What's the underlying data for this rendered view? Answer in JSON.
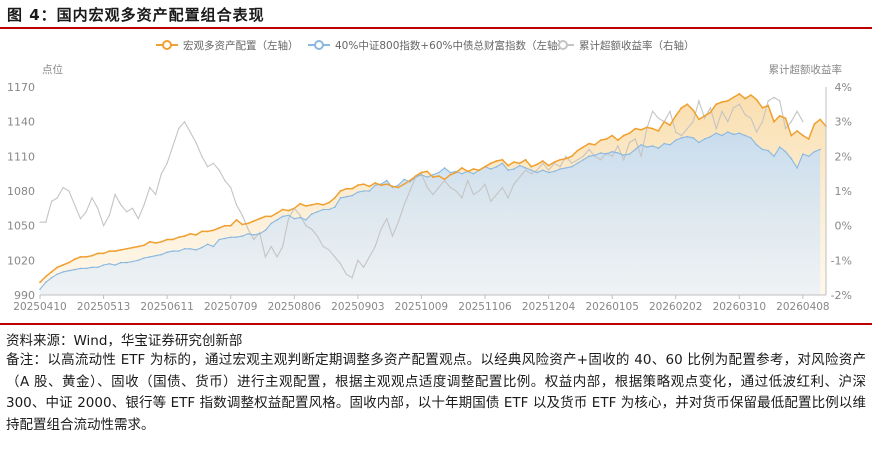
{
  "figure": {
    "title": "图 4：国内宏观多资产配置组合表现",
    "source": "资料来源：Wind，华宝证券研究创新部",
    "note": "备注：以高流动性 ETF 为标的，通过宏观主观判断定期调整多资产配置观点。以经典风险资产+固收的 40、60 比例为配置参考，对风险资产（A 股、黄金）、固收（国债、货币）进行主观配置，根据主观观点适度调整配置比例。权益内部，根据策略观点变化，通过低波红利、沪深 300、中证 2000、银行等 ETF 指数调整权益配置风格。固收内部，以十年期国债 ETF 以及货币 ETF 为核心，并对货币保留最低配置比例以维持配置组合流动性需求。"
  },
  "colors": {
    "accent_red": "#c00000",
    "portfolio": "#f0a030",
    "benchmark": "#8ab8e0",
    "excess": "#c4c4c4"
  },
  "chart_data": {
    "type": "line",
    "left_axis_label": "点位",
    "right_axis_label": "累计超额收益率",
    "ylim_left": [
      990,
      1170
    ],
    "yticks_left": [
      "990",
      "1020",
      "1050",
      "1080",
      "1110",
      "1140",
      "1170"
    ],
    "ylim_right": [
      -2,
      4
    ],
    "yticks_right": [
      "-2%",
      "-1%",
      "0%",
      "1%",
      "2%",
      "3%",
      "4%"
    ],
    "x_ticks": [
      "20250410",
      "20250513",
      "20250611",
      "20250709",
      "20250806",
      "20250903",
      "20251009",
      "20251106",
      "20251204",
      "20260105",
      "20260202",
      "20260310",
      "20260408"
    ],
    "x_tick_index": [
      0,
      11,
      22,
      33,
      44,
      55,
      66,
      77,
      88,
      99,
      110,
      121,
      132
    ],
    "grid": false,
    "legend_position": "top",
    "series": [
      {
        "name": "宏观多资产配置（左轴）",
        "axis": "left",
        "style": "line-area-markers",
        "values": [
          1001,
          1006,
          1010,
          1014,
          1016,
          1018,
          1021,
          1023,
          1023,
          1024,
          1026,
          1026,
          1028,
          1028,
          1029,
          1030,
          1031,
          1032,
          1033,
          1036,
          1035,
          1036,
          1038,
          1038,
          1040,
          1041,
          1043,
          1042,
          1045,
          1045,
          1046,
          1048,
          1050,
          1050,
          1055,
          1051,
          1052,
          1054,
          1056,
          1058,
          1058,
          1061,
          1064,
          1063,
          1065,
          1069,
          1067,
          1068,
          1069,
          1068,
          1070,
          1074,
          1080,
          1082,
          1082,
          1085,
          1086,
          1084,
          1087,
          1085,
          1086,
          1084,
          1083,
          1086,
          1089,
          1093,
          1096,
          1097,
          1092,
          1093,
          1090,
          1094,
          1096,
          1100,
          1097,
          1099,
          1098,
          1101,
          1104,
          1106,
          1107,
          1102,
          1105,
          1104,
          1107,
          1101,
          1103,
          1106,
          1102,
          1105,
          1107,
          1108,
          1110,
          1115,
          1118,
          1121,
          1120,
          1124,
          1125,
          1128,
          1124,
          1128,
          1130,
          1134,
          1133,
          1135,
          1134,
          1132,
          1140,
          1137,
          1145,
          1152,
          1155,
          1150,
          1142,
          1145,
          1148,
          1155,
          1157,
          1158,
          1161,
          1164,
          1160,
          1163,
          1159,
          1152,
          1154,
          1140,
          1145,
          1143,
          1128,
          1132,
          1128,
          1125,
          1138,
          1142,
          1136
        ]
      },
      {
        "name": "40%中证800指数+60%中债总财富指数（左轴）",
        "axis": "left",
        "style": "line-area-markers",
        "values": [
          995,
          1001,
          1005,
          1008,
          1010,
          1011,
          1012,
          1013,
          1013,
          1014,
          1014,
          1016,
          1017,
          1016,
          1018,
          1018,
          1019,
          1020,
          1022,
          1023,
          1024,
          1025,
          1027,
          1028,
          1028,
          1030,
          1030,
          1029,
          1031,
          1034,
          1032,
          1038,
          1039,
          1040,
          1040,
          1041,
          1043,
          1042,
          1043,
          1046,
          1052,
          1055,
          1058,
          1059,
          1056,
          1057,
          1055,
          1060,
          1062,
          1064,
          1064,
          1066,
          1074,
          1075,
          1076,
          1079,
          1080,
          1080,
          1085,
          1086,
          1089,
          1083,
          1085,
          1090,
          1088,
          1092,
          1094,
          1092,
          1094,
          1096,
          1100,
          1096,
          1097,
          1095,
          1097,
          1095,
          1098,
          1101,
          1099,
          1101,
          1104,
          1098,
          1099,
          1102,
          1100,
          1098,
          1096,
          1098,
          1096,
          1097,
          1099,
          1100,
          1101,
          1104,
          1107,
          1110,
          1111,
          1113,
          1112,
          1114,
          1113,
          1111,
          1112,
          1116,
          1120,
          1118,
          1119,
          1117,
          1121,
          1120,
          1124,
          1126,
          1127,
          1126,
          1122,
          1125,
          1127,
          1130,
          1128,
          1131,
          1129,
          1130,
          1128,
          1126,
          1120,
          1116,
          1115,
          1110,
          1118,
          1114,
          1108,
          1100,
          1112,
          1110,
          1114,
          1116
        ]
      },
      {
        "name": "累计超额收益率（右轴）",
        "axis": "right",
        "style": "line",
        "unit": "%",
        "values": [
          0.1,
          0.1,
          0.7,
          0.8,
          1.1,
          1.0,
          0.6,
          0.2,
          0.4,
          0.8,
          0.5,
          0.0,
          0.3,
          0.9,
          0.6,
          0.4,
          0.5,
          0.2,
          0.6,
          1.1,
          0.9,
          1.5,
          1.8,
          2.3,
          2.8,
          3.0,
          2.7,
          2.4,
          2.0,
          1.7,
          1.8,
          1.6,
          1.3,
          1.1,
          0.6,
          0.3,
          -0.1,
          -0.4,
          -0.2,
          -0.9,
          -0.6,
          -0.9,
          -0.6,
          0.2,
          0.5,
          0.3,
          0.0,
          -0.1,
          -0.3,
          -0.6,
          -0.7,
          -0.9,
          -1.1,
          -1.4,
          -1.5,
          -1.0,
          -1.2,
          -0.9,
          -0.6,
          -0.1,
          0.2,
          -0.3,
          0.1,
          0.6,
          1.0,
          1.4,
          1.5,
          1.1,
          0.9,
          1.1,
          1.3,
          1.1,
          1.0,
          0.8,
          1.3,
          0.9,
          1.0,
          1.2,
          0.7,
          0.9,
          1.1,
          0.8,
          1.2,
          1.4,
          1.6,
          1.5,
          1.6,
          1.8,
          1.6,
          1.8,
          1.7,
          2.0,
          1.8,
          1.9,
          2.0,
          2.2,
          2.0,
          1.9,
          2.1,
          2.0,
          2.3,
          1.9,
          2.4,
          2.5,
          2.0,
          2.8,
          3.3,
          3.1,
          3.0,
          3.3,
          2.7,
          2.6,
          2.8,
          3.0,
          3.6,
          3.1,
          3.4,
          2.8,
          3.3,
          3.0,
          3.4,
          3.5,
          3.2,
          3.1,
          2.7,
          3.0,
          3.6,
          3.7,
          3.6,
          2.8,
          3.0,
          3.3,
          3.0
        ]
      }
    ]
  }
}
